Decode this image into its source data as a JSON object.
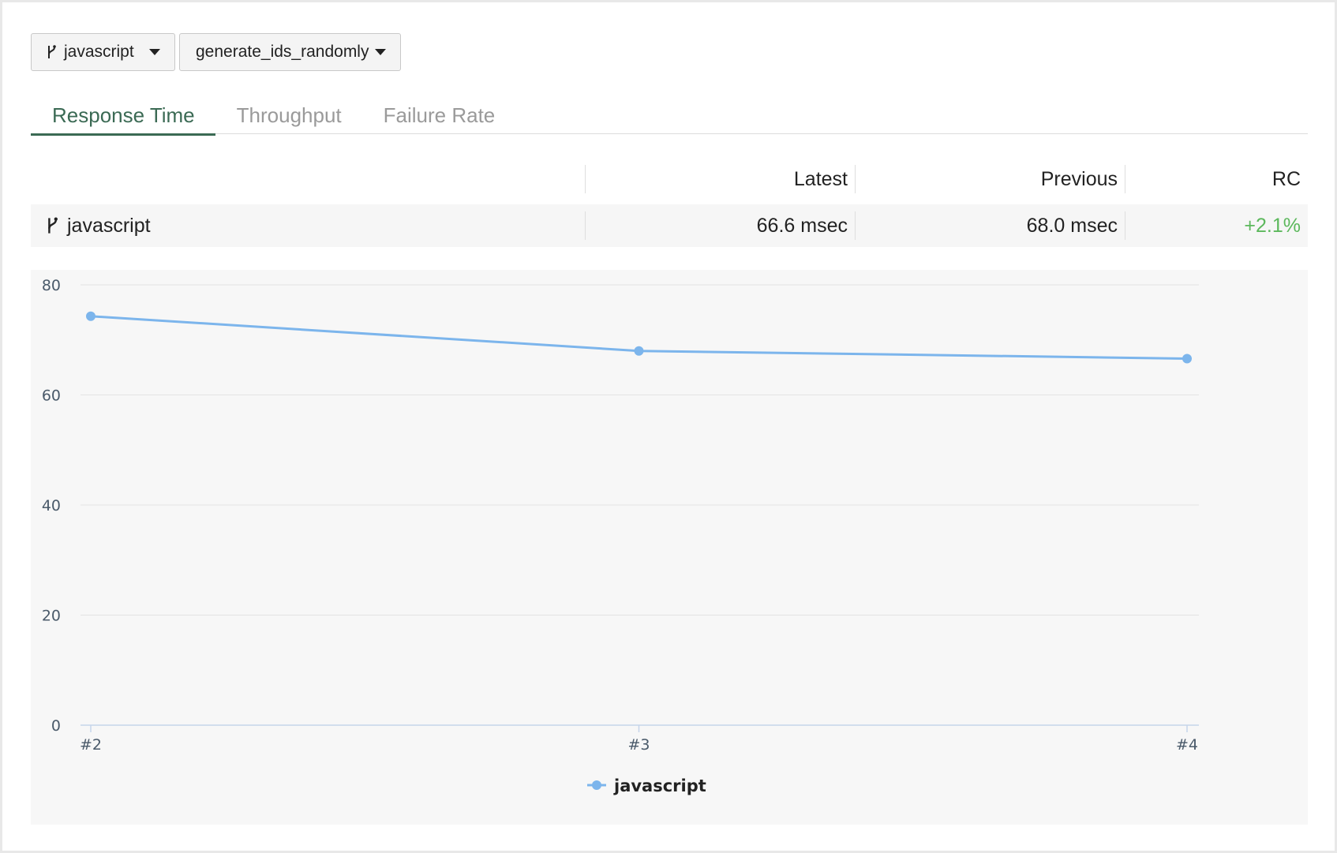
{
  "filters": {
    "branch": "javascript",
    "test": "generate_ids_randomly"
  },
  "tabs": [
    {
      "label": "Response Time",
      "active": true
    },
    {
      "label": "Throughput",
      "active": false
    },
    {
      "label": "Failure Rate",
      "active": false
    }
  ],
  "summary": {
    "headers": {
      "latest": "Latest",
      "previous": "Previous",
      "rc": "RC"
    },
    "rows": [
      {
        "name": "javascript",
        "latest": "66.6 msec",
        "previous": "68.0 msec",
        "rc": "+2.1%"
      }
    ]
  },
  "colors": {
    "accent": "#3b6a54",
    "series": "#7cb5ec",
    "positive": "#5cb85c"
  },
  "chart_data": {
    "type": "line",
    "x": [
      "#2",
      "#3",
      "#4"
    ],
    "series": [
      {
        "name": "javascript",
        "values": [
          74.3,
          68.0,
          66.6
        ]
      }
    ],
    "ylim": [
      0,
      80
    ],
    "yticks": [
      0,
      20,
      40,
      60,
      80
    ],
    "grid": true,
    "legend": "bottom-center"
  }
}
